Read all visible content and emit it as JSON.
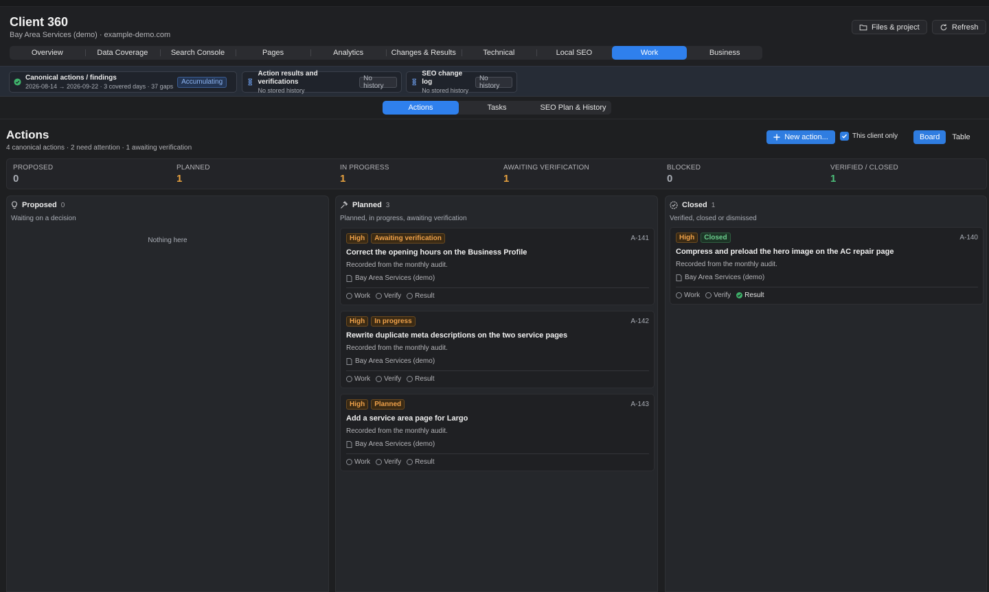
{
  "app": {
    "title": "Client 360",
    "subtitle": "Bay Area Services (demo) · example-demo.com"
  },
  "header_buttons": {
    "files": "Files & project",
    "refresh": "Refresh"
  },
  "main_tabs": [
    "Overview",
    "Data Coverage",
    "Search Console",
    "Pages",
    "Analytics",
    "Changes & Results",
    "Technical",
    "Local SEO",
    "Work",
    "Business"
  ],
  "active_main_tab": "Work",
  "status_chips": [
    {
      "title": "Canonical actions / findings",
      "detail": "2026-08-14 → 2026-09-22 · 3 covered days · 37 gaps",
      "badge": "Accumulating"
    },
    {
      "title": "Action results and verifications",
      "detail": "No stored history",
      "badge": "No history"
    },
    {
      "title": "SEO change log",
      "detail": "No stored history",
      "badge": "No history"
    }
  ],
  "sub_tabs": [
    "Actions",
    "Tasks",
    "SEO Plan & History"
  ],
  "active_sub_tab": "Actions",
  "section": {
    "title": "Actions",
    "summary": "4 canonical actions · 2 need attention · 1 awaiting verification"
  },
  "toolbar": {
    "new_action": "New action...",
    "client_only": "This client only",
    "client_only_checked": true,
    "view_board": "Board",
    "view_table": "Table",
    "active_view": "Board"
  },
  "stats": [
    {
      "label": "PROPOSED",
      "value": "0",
      "color": "#a9adb5"
    },
    {
      "label": "PLANNED",
      "value": "1",
      "color": "#e8a23f"
    },
    {
      "label": "IN PROGRESS",
      "value": "1",
      "color": "#e8a23f"
    },
    {
      "label": "AWAITING VERIFICATION",
      "value": "1",
      "color": "#e8a23f"
    },
    {
      "label": "BLOCKED",
      "value": "0",
      "color": "#a9adb5"
    },
    {
      "label": "VERIFIED / CLOSED",
      "value": "1",
      "color": "#4cc07a"
    }
  ],
  "columns": {
    "proposed": {
      "name": "Proposed",
      "count": "0",
      "description": "Waiting on a decision",
      "empty": "Nothing here"
    },
    "planned": {
      "name": "Planned",
      "count": "3",
      "description": "Planned, in progress, awaiting verification"
    },
    "closed": {
      "name": "Closed",
      "count": "1",
      "description": "Verified, closed or dismissed"
    }
  },
  "cards": {
    "planned": [
      {
        "priority": "High",
        "status": "Awaiting verification",
        "id": "A-141",
        "title": "Correct the opening hours on the Business Profile",
        "note": "Recorded from the monthly audit.",
        "client": "Bay Area Services (demo)",
        "steps": [
          "Work",
          "Verify",
          "Result"
        ]
      },
      {
        "priority": "High",
        "status": "In progress",
        "id": "A-142",
        "title": "Rewrite duplicate meta descriptions on the two service pages",
        "note": "Recorded from the monthly audit.",
        "client": "Bay Area Services (demo)",
        "steps": [
          "Work",
          "Verify",
          "Result"
        ]
      },
      {
        "priority": "High",
        "status": "Planned",
        "id": "A-143",
        "title": "Add a service area page for Largo",
        "note": "Recorded from the monthly audit.",
        "client": "Bay Area Services (demo)",
        "steps": [
          "Work",
          "Verify",
          "Result"
        ]
      }
    ],
    "closed": [
      {
        "priority": "High",
        "status": "Closed",
        "id": "A-140",
        "title": "Compress and preload the hero image on the AC repair page",
        "note": "Recorded from the monthly audit.",
        "client": "Bay Area Services (demo)",
        "steps": [
          "Work",
          "Verify",
          "Result"
        ],
        "result_done": true
      }
    ]
  }
}
